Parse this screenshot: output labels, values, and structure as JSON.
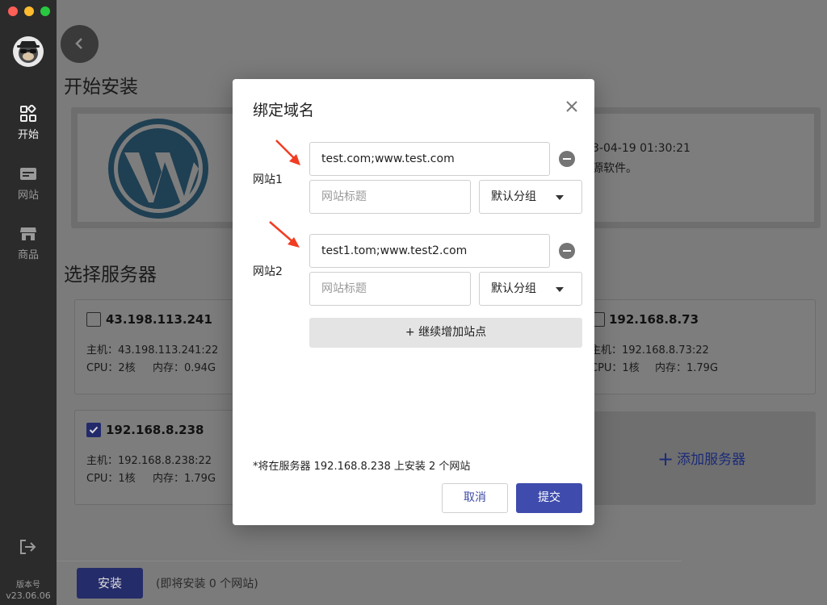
{
  "sidebar": {
    "nav": [
      {
        "label": "开始",
        "icon": "grid-icon",
        "active": true
      },
      {
        "label": "网站",
        "icon": "website-icon",
        "active": false
      },
      {
        "label": "商品",
        "icon": "store-icon",
        "active": false
      }
    ],
    "version_label": "版本号",
    "version": "v23.06.06"
  },
  "main": {
    "install_title": "开始安装",
    "app": {
      "date": "3-04-19 01:30:21",
      "desc": "源软件。"
    },
    "server_title": "选择服务器",
    "servers": [
      {
        "ip": "43.198.113.241",
        "host": "主机：43.198.113.241:22",
        "cpu": "CPU：2核",
        "mem": "内存：0.94G",
        "checked": false
      },
      {
        "ip": "192.168.8.238",
        "host": "主机：192.168.8.238:22",
        "cpu": "CPU：1核",
        "mem": "内存：1.79G",
        "checked": true
      },
      {
        "ip": "192.168.8.73",
        "host": "主机：192.168.8.73:22",
        "cpu": "CPU：1核",
        "mem": "内存：1.79G",
        "checked": false
      }
    ],
    "add_server": "添加服务器",
    "install_button": "安装",
    "install_note": "(即将安装 0 个网站)"
  },
  "modal": {
    "title": "绑定域名",
    "sites": [
      {
        "label": "网站1",
        "domain": "test.com;www.test.com",
        "title_placeholder": "网站标题",
        "group": "默认分组"
      },
      {
        "label": "网站2",
        "domain": "test1.tom;www.test2.com",
        "title_placeholder": "网站标题",
        "group": "默认分组"
      }
    ],
    "add_site": "+ 继续增加站点",
    "note": "*将在服务器 192.168.8.238 上安装 2 个网站",
    "cancel": "取消",
    "submit": "提交"
  },
  "colors": {
    "primary": "#3f4cad",
    "sidebar_bg": "#2b2b2b",
    "overlay": "#7b7b7b",
    "arrow": "#f23c22"
  }
}
